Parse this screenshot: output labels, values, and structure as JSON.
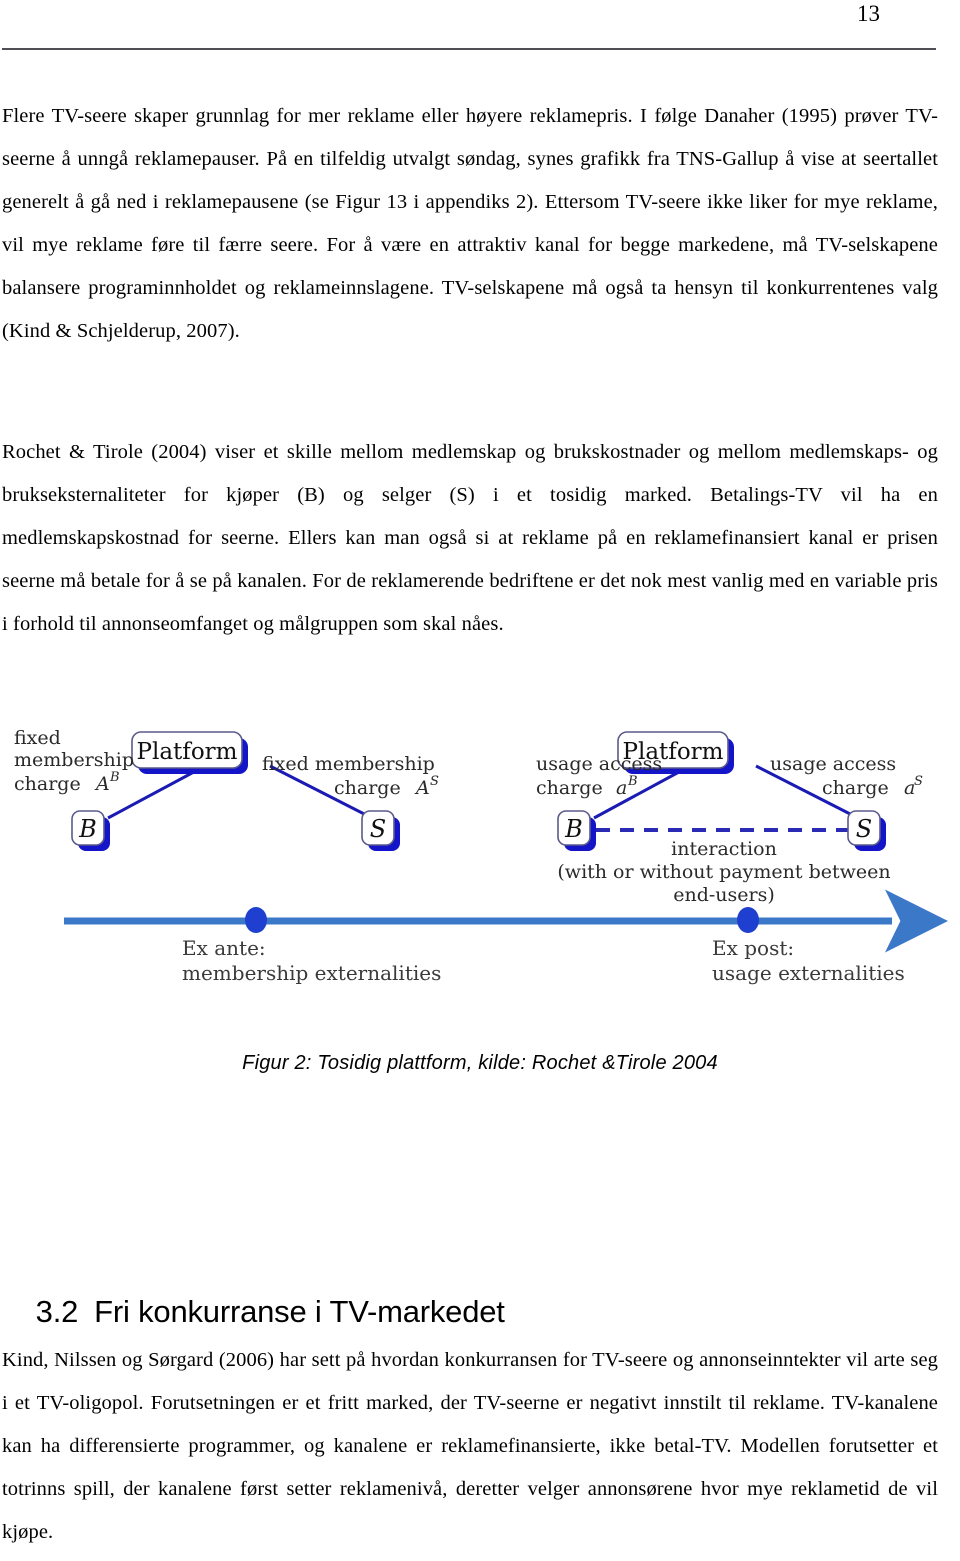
{
  "header": {
    "page_number": "13"
  },
  "paragraphs": {
    "p1": "Flere TV-seere skaper grunnlag for mer reklame eller høyere reklamepris. I følge Danaher (1995) prøver TV-seerne å unngå reklamepauser. På en tilfeldig utvalgt søndag, synes grafikk fra TNS-Gallup å vise at seertallet generelt å gå ned i reklamepausene (se Figur 13 i appendiks 2). Ettersom TV-seere ikke liker for mye reklame, vil mye reklame føre til færre seere. For å være en attraktiv kanal for begge markedene, må TV-selskapene balansere programinnholdet og reklameinnslagene. TV-selskapene må også ta hensyn til konkurrentenes valg (Kind & Schjelderup, 2007).",
    "p2": "Rochet & Tirole (2004) viser et skille mellom medlemskap og brukskostnader og mellom medlemskaps- og brukseksternaliteter for kjøper (B) og selger (S) i et tosidig marked. Betalings-TV vil ha en medlemskapskostnad for seerne. Ellers kan man også si at reklame på en reklamefinansiert kanal er prisen seerne må betale for å se på kanalen. For de reklamerende bedriftene er det nok mest vanlig med en variable pris i forhold til annonseomfanget og målgruppen som skal nåes.",
    "p3": "Kind, Nilssen og Sørgard (2006) har sett på hvordan konkurransen for TV-seere og annonseinntekter vil arte seg i et TV-oligopol. Forutsetningen er et fritt marked, der TV-seerne er negativt innstilt til reklame. TV-kanalene kan ha differensierte programmer, og kanalene er reklamefinansierte, ikke betal-TV. Modellen forutsetter et totrinns spill, der kanalene først setter reklamenivå, deretter velger annonsørene hvor mye reklametid de vil kjøpe."
  },
  "figure": {
    "caption": "Figur 2: Tosidig plattform, kilde: Rochet &Tirole 2004",
    "colors": {
      "edge_blue": "#1a1ab4",
      "box_border": "#5a5a8c",
      "shadow_blue": "#1414c8",
      "timeline_blue": "#3c78c8",
      "dot_blue": "#1f3fd0"
    },
    "left_panel": {
      "platform_label": "Platform",
      "buyer_label": "B",
      "seller_label": "S",
      "left_charge_line1": "fixed",
      "left_charge_line2": "membership",
      "left_charge_line3": "charge",
      "left_charge_symbol": "A",
      "left_charge_superscript": "B",
      "right_charge_line1": "fixed membership",
      "right_charge_line2": "charge",
      "right_charge_symbol": "A",
      "right_charge_superscript": "S"
    },
    "right_panel": {
      "platform_label": "Platform",
      "buyer_label": "B",
      "seller_label": "S",
      "left_charge_line1": "usage access",
      "left_charge_line2": "charge",
      "left_charge_symbol": "a",
      "left_charge_superscript": "B",
      "right_charge_line1": "usage access",
      "right_charge_line2": "charge",
      "right_charge_symbol": "a",
      "right_charge_superscript": "S",
      "interaction_line1": "interaction",
      "interaction_line2": "(with or without payment between",
      "interaction_line3": "end-users)"
    },
    "timeline": {
      "ex_ante_line1": "Ex ante:",
      "ex_ante_line2": "membership externalities",
      "ex_post_line1": "Ex post:",
      "ex_post_line2": "usage externalities"
    }
  },
  "section": {
    "number": "3.2",
    "title": "Fri konkurranse i TV-markedet"
  }
}
